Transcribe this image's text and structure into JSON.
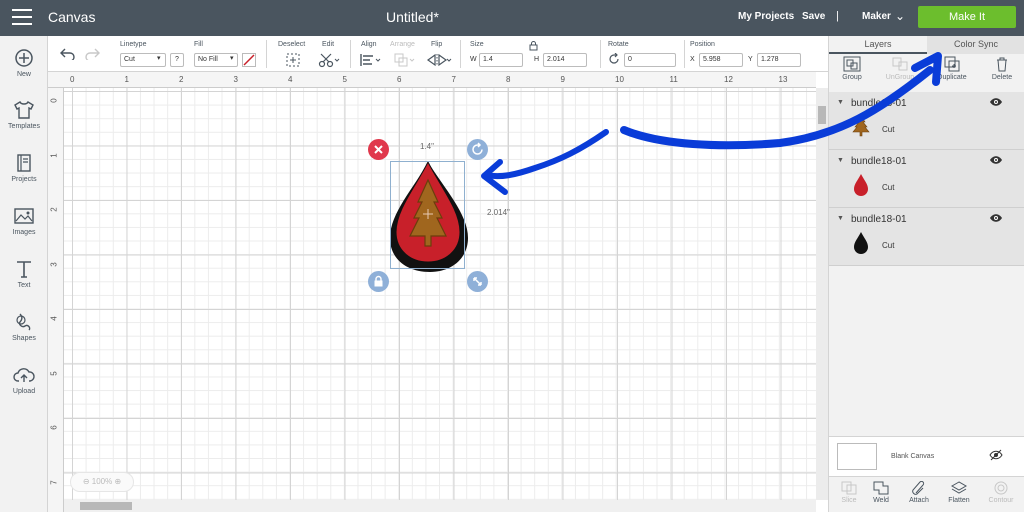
{
  "topbar": {
    "app_name": "Canvas",
    "doc_title": "Untitled*",
    "my_projects": "My Projects",
    "save": "Save",
    "separator": "|",
    "machine": "Maker",
    "make_it": "Make It"
  },
  "sidebar": {
    "new": "New",
    "templates": "Templates",
    "projects": "Projects",
    "images": "Images",
    "text": "Text",
    "shapes": "Shapes",
    "upload": "Upload"
  },
  "toolbar": {
    "linetype_label": "Linetype",
    "linetype_value": "Cut",
    "help": "?",
    "fill_label": "Fill",
    "fill_value": "No Fill",
    "deselect": "Deselect",
    "edit": "Edit",
    "align": "Align",
    "arrange": "Arrange",
    "flip": "Flip",
    "size_label": "Size",
    "w_label": "W",
    "w_value": "1.4",
    "h_label": "H",
    "h_value": "2.014",
    "rotate_label": "Rotate",
    "rotate_value": "0",
    "position_label": "Position",
    "x_label": "X",
    "x_value": "5.958",
    "y_label": "Y",
    "y_value": "1.278"
  },
  "ruler": {
    "h_ticks": [
      "0",
      "1",
      "2",
      "3",
      "4",
      "5",
      "6",
      "7",
      "8",
      "9",
      "10",
      "11",
      "12",
      "13"
    ],
    "v_ticks": [
      "0",
      "1",
      "2",
      "3",
      "4",
      "5",
      "6",
      "7"
    ]
  },
  "selection": {
    "width_label": "1.4\"",
    "height_label": "2.014\""
  },
  "zoom": {
    "value": "100%"
  },
  "panel": {
    "tab_layers": "Layers",
    "tab_color_sync": "Color Sync",
    "group": "Group",
    "ungroup": "UnGroup",
    "duplicate": "Duplicate",
    "delete": "Delete",
    "layers": [
      {
        "name": "bundle18-01",
        "sub": "Cut",
        "thumb": "tree-icon"
      },
      {
        "name": "bundle18-01",
        "sub": "Cut",
        "thumb": "red-drop-icon"
      },
      {
        "name": "bundle18-01",
        "sub": "Cut",
        "thumb": "black-drop-icon"
      }
    ],
    "blank_canvas": "Blank Canvas",
    "bottom": {
      "slice": "Slice",
      "weld": "Weld",
      "attach": "Attach",
      "flatten": "Flatten",
      "contour": "Contour"
    }
  },
  "colors": {
    "topbar": "#4a555f",
    "make_it": "#6cbe2d",
    "drop_red": "#c8202a",
    "tree_brown": "#a0661e",
    "annotation_blue": "#0a3cd8"
  }
}
